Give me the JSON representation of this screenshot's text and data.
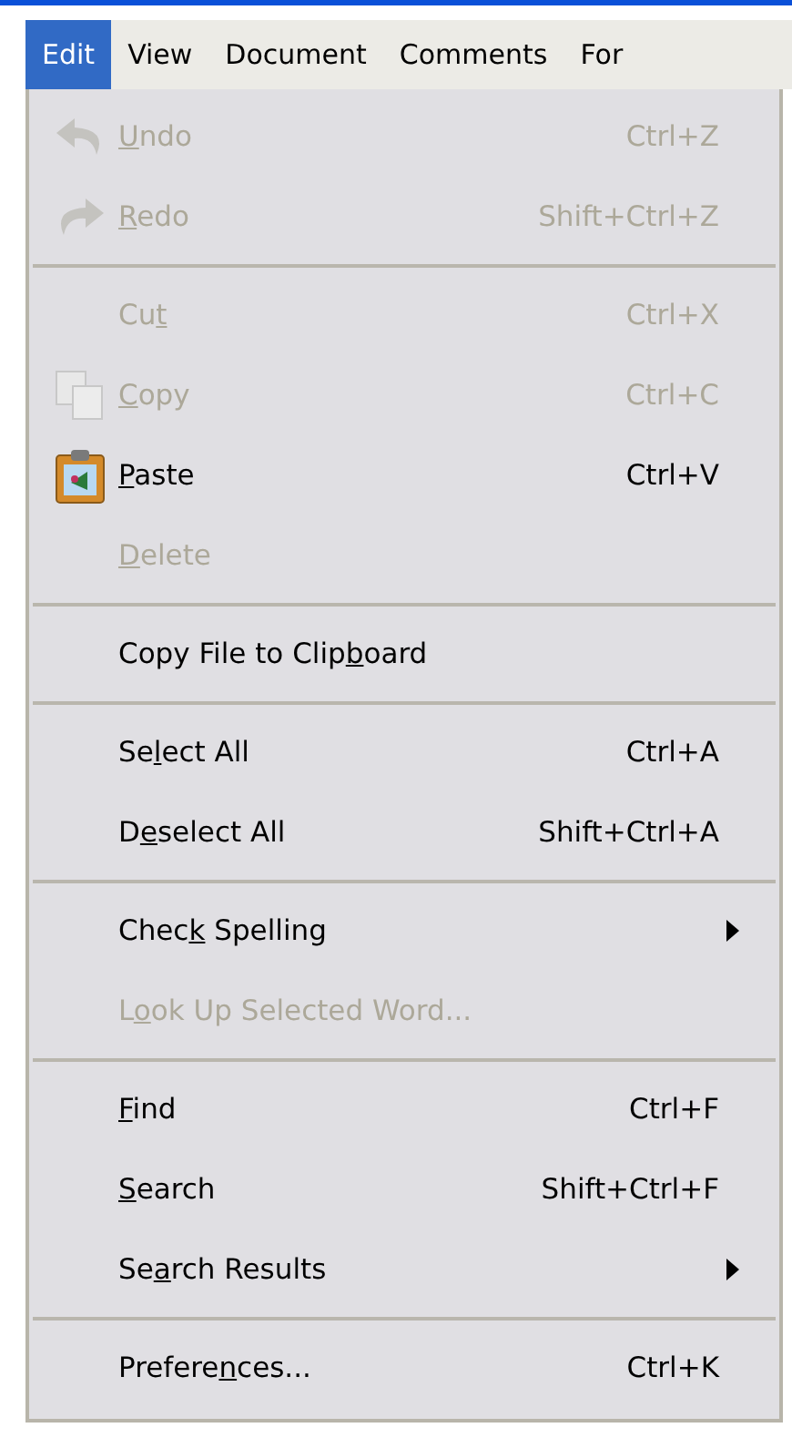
{
  "menubar": [
    {
      "label": "Edit",
      "selected": true
    },
    {
      "label": "View",
      "selected": false
    },
    {
      "label": "Document",
      "selected": false
    },
    {
      "label": "Comments",
      "selected": false
    },
    {
      "label": "For",
      "selected": false
    }
  ],
  "menu": [
    {
      "kind": "undo",
      "label": {
        "key": "U",
        "after": "ndo"
      },
      "shortcut": "Ctrl+Z",
      "disabled": true
    },
    {
      "kind": "redo",
      "label": {
        "key": "R",
        "after": "edo"
      },
      "shortcut": "Shift+Ctrl+Z",
      "disabled": true
    },
    {
      "kind": "separator"
    },
    {
      "kind": "item",
      "label": {
        "before": "Cu",
        "key": "t"
      },
      "shortcut": "Ctrl+X",
      "disabled": true
    },
    {
      "kind": "copy",
      "label": {
        "key": "C",
        "after": "opy"
      },
      "shortcut": "Ctrl+C",
      "disabled": true
    },
    {
      "kind": "paste",
      "label": {
        "key": "P",
        "after": "aste"
      },
      "shortcut": "Ctrl+V",
      "disabled": false
    },
    {
      "kind": "item",
      "label": {
        "key": "D",
        "after": "elete"
      },
      "disabled": true
    },
    {
      "kind": "separator"
    },
    {
      "kind": "item",
      "label": {
        "before": "Copy File to Clip",
        "key": "b",
        "after": "oard"
      },
      "disabled": false
    },
    {
      "kind": "separator"
    },
    {
      "kind": "item",
      "label": {
        "before": "Se",
        "key": "l",
        "after": "ect All"
      },
      "shortcut": "Ctrl+A",
      "disabled": false
    },
    {
      "kind": "item",
      "label": {
        "before": "D",
        "key": "e",
        "after": "select All"
      },
      "shortcut": "Shift+Ctrl+A",
      "disabled": false
    },
    {
      "kind": "separator"
    },
    {
      "kind": "submenu",
      "label": {
        "before": "Chec",
        "key": "k",
        "after": " Spelling"
      },
      "disabled": false
    },
    {
      "kind": "item",
      "label": {
        "before": "L",
        "key": "o",
        "after": "ok Up Selected Word..."
      },
      "disabled": true
    },
    {
      "kind": "separator"
    },
    {
      "kind": "item",
      "label": {
        "key": "F",
        "after": "ind"
      },
      "shortcut": "Ctrl+F",
      "disabled": false
    },
    {
      "kind": "item",
      "label": {
        "key": "S",
        "after": "earch"
      },
      "shortcut": "Shift+Ctrl+F",
      "disabled": false
    },
    {
      "kind": "submenu",
      "label": {
        "before": "Se",
        "key": "a",
        "after": "rch Results"
      },
      "disabled": false
    },
    {
      "kind": "separator"
    },
    {
      "kind": "item",
      "label": {
        "before": "Prefere",
        "key": "n",
        "after": "ces..."
      },
      "shortcut": "Ctrl+K",
      "disabled": false
    }
  ]
}
